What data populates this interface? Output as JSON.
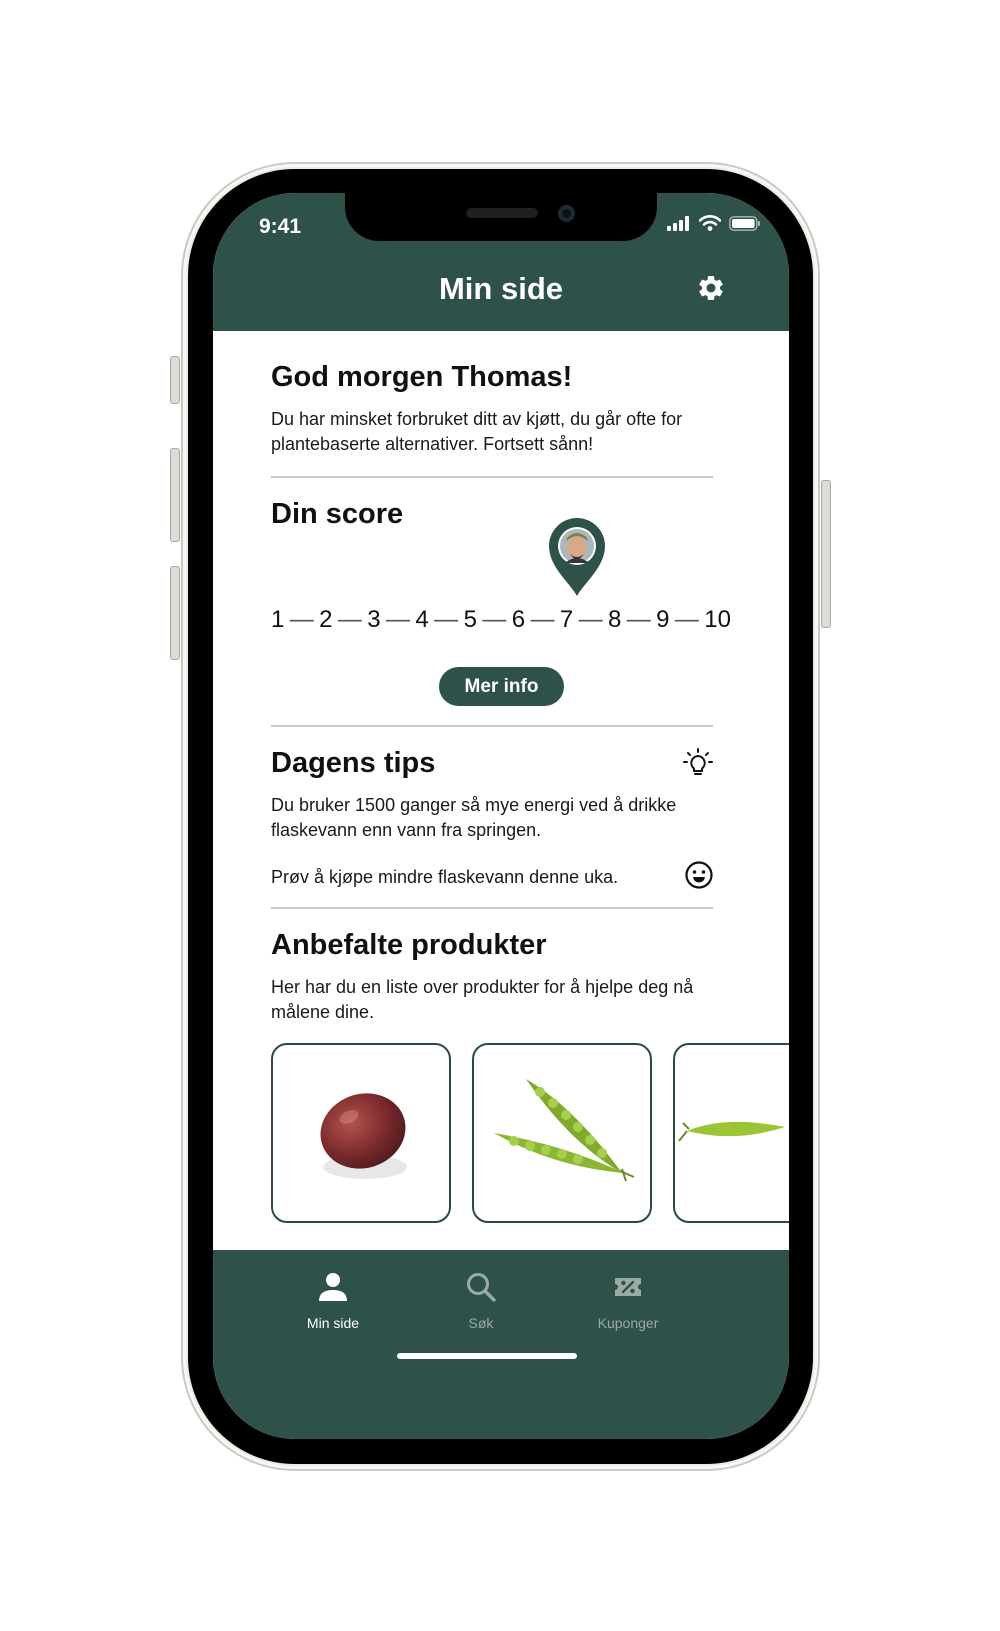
{
  "status_bar": {
    "time": "9:41"
  },
  "header": {
    "title": "Min side"
  },
  "greeting": {
    "title": "God morgen Thomas!",
    "text": "Du har minsket forbruket ditt av kjøtt, du går ofte for plantebaserte alternativer. Fortsett sånn!"
  },
  "score": {
    "title": "Din score",
    "scale": [
      "1",
      "2",
      "3",
      "4",
      "5",
      "6",
      "7",
      "8",
      "9",
      "10"
    ],
    "separator": "—",
    "current": 7.5,
    "button_label": "Mer info"
  },
  "tips": {
    "title": "Dagens tips",
    "text": "Du bruker 1500 ganger så mye energi ved å drikke flaskevann enn vann fra springen.",
    "suggestion": "Prøv å kjøpe mindre flaskevann denne uka."
  },
  "products": {
    "title": "Anbefalte produkter",
    "text": "Her har du en liste over produkter for å hjelpe deg nå målene dine.",
    "items": [
      "mango",
      "pea-pod",
      "pea-pod"
    ]
  },
  "tabbar": {
    "tabs": [
      {
        "label": "Min side",
        "icon": "person-icon",
        "active": true
      },
      {
        "label": "Søk",
        "icon": "search-icon",
        "active": false
      },
      {
        "label": "Kuponger",
        "icon": "coupon-icon",
        "active": false
      }
    ]
  },
  "colors": {
    "brand": "#2e5249",
    "inactive_tab": "#9aaaa5",
    "active_tab": "#ffffff"
  }
}
